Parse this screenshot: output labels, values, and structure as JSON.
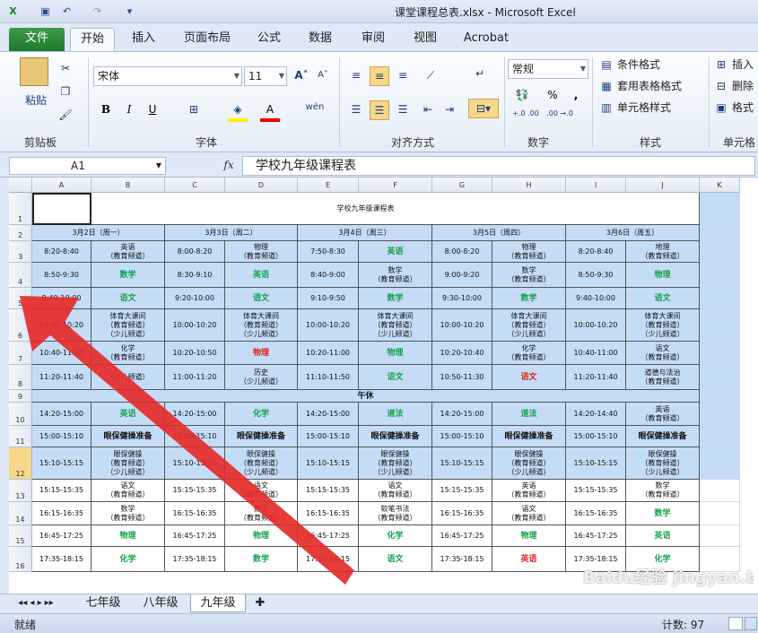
{
  "window": {
    "title": "课堂课程总表.xlsx - Microsoft Excel",
    "quick_access": [
      "save-icon",
      "undo-icon",
      "redo-icon",
      "customize-icon"
    ]
  },
  "tabs": [
    "文件",
    "开始",
    "插入",
    "页面布局",
    "公式",
    "数据",
    "审阅",
    "视图",
    "Acrobat"
  ],
  "ribbon": {
    "clipboard": {
      "paste": "粘贴",
      "label": "剪贴板"
    },
    "font": {
      "name": "宋体",
      "size": "11",
      "bold": "B",
      "italic": "I",
      "underline": "U",
      "wen": "wén",
      "label": "字体"
    },
    "alignment": {
      "label": "对齐方式"
    },
    "number": {
      "format": "常规",
      "label": "数字",
      "percent": "%",
      "comma": ",",
      "inc": "+.0 .00",
      "dec": ".00 →.0"
    },
    "styles": {
      "cond": "条件格式",
      "table": "套用表格格式",
      "cell": "单元格样式",
      "label": "样式"
    },
    "cells": {
      "insert": "插入",
      "delete": "删除",
      "format": "格式",
      "label": "单元格"
    }
  },
  "formula": {
    "namebox": "A1",
    "fx": "fx",
    "value": "学校九年级课程表"
  },
  "columns": [
    "A",
    "B",
    "C",
    "D",
    "E",
    "F",
    "G",
    "H",
    "I",
    "J",
    "K"
  ],
  "rows": [
    "1",
    "2",
    "3",
    "4",
    "5",
    "6",
    "7",
    "8",
    "9",
    "10",
    "11",
    "12",
    "13",
    "14",
    "15",
    "16"
  ],
  "sheet": {
    "title": "学校九年级课程表",
    "days": [
      "3月2日（周一）",
      "3月3日（周二）",
      "3月4日（周三）",
      "3月5日（周四）",
      "3月6日（周五）"
    ],
    "r3": [
      "8:20-8:40",
      "英语\n（教育频道）",
      "8:00-8:20",
      "物理\n（教育频道）",
      "7:50-8:30",
      "英语",
      "8:00-8:20",
      "物理\n（教育频道）",
      "8:20-8:40",
      "地理\n（教育频道）"
    ],
    "r4": [
      "8:50-9:30",
      "数学",
      "8:30-9:10",
      "英语",
      "8:40-9:00",
      "数学\n（教育频道）",
      "9:00-9:20",
      "数学\n（教育频道）",
      "8:50-9:30",
      "物理"
    ],
    "r5": [
      "9:40-10:00",
      "语文",
      "9:20-10:00",
      "语文",
      "9:10-9:50",
      "数学",
      "9:30-10:00",
      "数学",
      "9:40-10:00",
      "语文"
    ],
    "r6": [
      "10:00-10:20",
      "体育大课间\n（教育频道）\n（少儿频道）",
      "10:00-10:20",
      "体育大课间\n（教育频道）\n（少儿频道）",
      "10:00-10:20",
      "体育大课间\n（教育频道）\n（少儿频道）",
      "10:00-10:20",
      "体育大课间\n（教育频道）\n（少儿频道）",
      "10:00-10:20",
      "体育大课间\n（教育频道）\n（少儿频道）"
    ],
    "r7": [
      "10:40-11:00",
      "化学\n（教育频道）",
      "10:20-10:50",
      "物理",
      "10:20-11:00",
      "物理",
      "10:20-10:40",
      "化学\n（教育频道）",
      "10:40-11:00",
      "语文\n（教育频道）"
    ],
    "r8": [
      "11:20-11:40",
      "（少儿频道）",
      "11:00-11:20",
      "历史\n（少儿频道）",
      "11:10-11:50",
      "语文",
      "10:50-11:30",
      "语文",
      "11:20-11:40",
      "道德与法治\n（教育频道）"
    ],
    "lunch": "午休",
    "r10": [
      "14:20-15:00",
      "英语",
      "14:20-15:00",
      "化学",
      "14:20-15:00",
      "道法",
      "14:20-15:00",
      "道法",
      "14:20-14:40",
      "英语\n（教育频道）"
    ],
    "r11": [
      "15:00-15:10",
      "眼保健操准备",
      "15:00-15:10",
      "眼保健操准备",
      "15:00-15:10",
      "眼保健操准备",
      "15:00-15:10",
      "眼保健操准备",
      "15:00-15:10",
      "眼保健操准备"
    ],
    "r12": [
      "15:10-15:15",
      "眼保健操\n（教育频道）\n（少儿频道）",
      "15:10-15:15",
      "眼保健操\n（教育频道）\n（少儿频道）",
      "15:10-15:15",
      "眼保健操\n（教育频道）\n（少儿频道）",
      "15:10-15:15",
      "眼保健操\n（教育频道）\n（少儿频道）",
      "15:10-15:15",
      "眼保健操\n（教育频道）\n（少儿频道）"
    ],
    "r13": [
      "15:15-15:35",
      "语文\n（教育频道）",
      "15:15-15:35",
      "语文\n（教育频道）",
      "15:15-15:35",
      "语文\n（教育频道）",
      "15:15-15:35",
      "英语\n（教育频道）",
      "15:15-15:35",
      "数学\n（教育频道）"
    ],
    "r14": [
      "16:15-16:35",
      "数学\n（教育频道）",
      "16:15-16:35",
      "数学\n（教育频道）",
      "16:15-16:35",
      "软笔书法\n（教育频道）",
      "16:15-16:35",
      "语文\n（教育频道）",
      "16:15-16:35",
      "数学"
    ],
    "r15": [
      "16:45-17:25",
      "物理",
      "16:45-17:25",
      "物理",
      "16:45-17:25",
      "化学",
      "16:45-17:25",
      "物理",
      "16:45-17:25",
      "英语"
    ],
    "r16": [
      "17:35-18:15",
      "化学",
      "17:35-18:15",
      "数学",
      "17:35-18:15",
      "语文",
      "17:35-18:15",
      "英语",
      "17:35-18:15",
      "化学"
    ]
  },
  "sheet_tabs": [
    "七年级",
    "八年级",
    "九年级"
  ],
  "status": {
    "ready": "就绪",
    "count": "计数: 97"
  },
  "watermark": "Baidu经验 jingyan.baidu.com",
  "colors": {
    "header_blue": "#c5dcf6",
    "green": "#12a34a",
    "red": "#e02020",
    "arrow": "#e52b2b"
  }
}
